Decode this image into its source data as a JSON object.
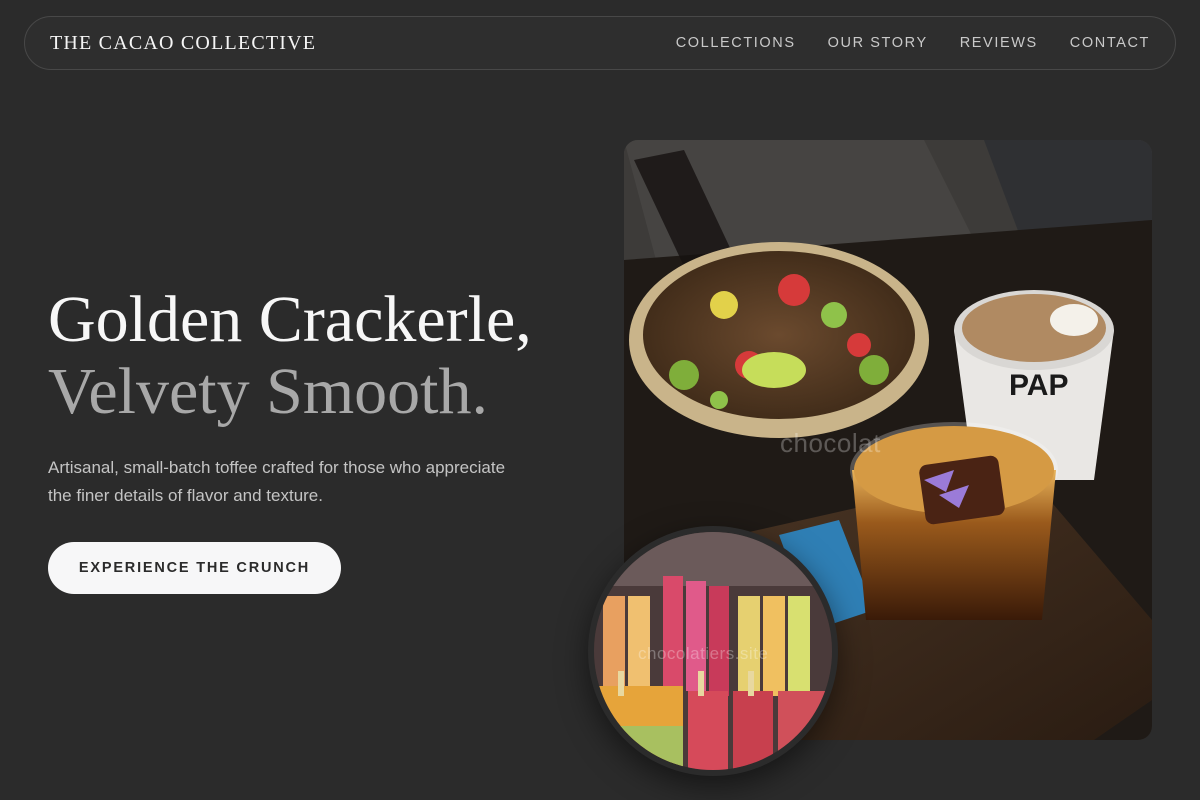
{
  "brand": "THE CACAO COLLECTIVE",
  "nav": {
    "items": [
      {
        "label": "COLLECTIONS"
      },
      {
        "label": "OUR STORY"
      },
      {
        "label": "REVIEWS"
      },
      {
        "label": "CONTACT"
      }
    ]
  },
  "hero": {
    "title_line1": "Golden Crackerle,",
    "title_line2": "Velvety Smooth.",
    "description": "Artisanal, small-batch toffee crafted for those who appreciate the finer details of flavor and texture.",
    "cta_label": "EXPERIENCE THE CRUNCH"
  },
  "images": {
    "main_watermark": "chocolat",
    "circle_watermark": "chocolatiers.site",
    "cup_brand": "PAP"
  },
  "colors": {
    "background": "#2b2b2b",
    "nav_border": "#484848",
    "text_primary": "#f7f7f7",
    "text_muted": "#a8a8a8",
    "cta_bg": "#f7f7f8"
  }
}
